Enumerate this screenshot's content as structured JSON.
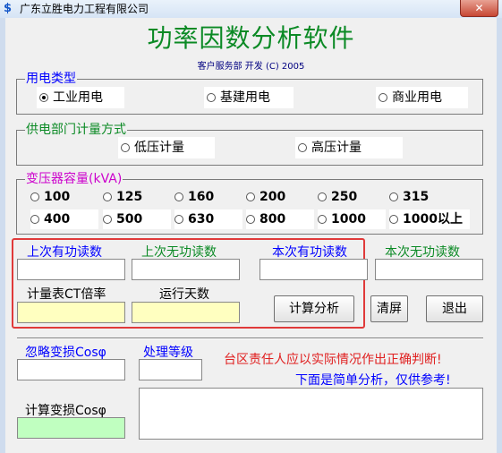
{
  "window": {
    "title": "广东立胜电力工程有限公司",
    "close_glyph": "✕"
  },
  "header": {
    "title": "功率因数分析软件",
    "subtitle": "客户服务部 开发 (C) 2005"
  },
  "usage_type": {
    "legend": "用电类型",
    "options": [
      "工业用电",
      "基建用电",
      "商业用电"
    ],
    "selected": 0
  },
  "metering": {
    "legend": "供电部门计量方式",
    "options": [
      "低压计量",
      "高压计量"
    ],
    "selected": -1
  },
  "transformer": {
    "legend": "变压器容量(kVA)",
    "options": [
      "100",
      "125",
      "160",
      "200",
      "250",
      "315",
      "400",
      "500",
      "630",
      "800",
      "1000",
      "1000以上"
    ]
  },
  "readings": {
    "prev_active_label": "上次有功读数",
    "prev_reactive_label": "上次无功读数",
    "curr_active_label": "本次有功读数",
    "curr_reactive_label": "本次无功读数",
    "ct_ratio_label": "计量表CT倍率",
    "run_days_label": "运行天数"
  },
  "buttons": {
    "calculate": "计算分析",
    "clear": "清屏",
    "exit": "退出"
  },
  "results": {
    "ignore_loss_label": "忽略变损Cosφ",
    "level_label": "处理等级",
    "calc_loss_label": "计算变损Cosφ"
  },
  "notice": {
    "line1": "台区责任人应以实际情况作出正确判断!",
    "line2": "下面是简单分析，仅供参考!"
  },
  "colors": {
    "green": "#0b8a25",
    "blue": "#0000ff",
    "purple": "#cc00cc",
    "red": "#e02020",
    "navy": "#000080"
  }
}
